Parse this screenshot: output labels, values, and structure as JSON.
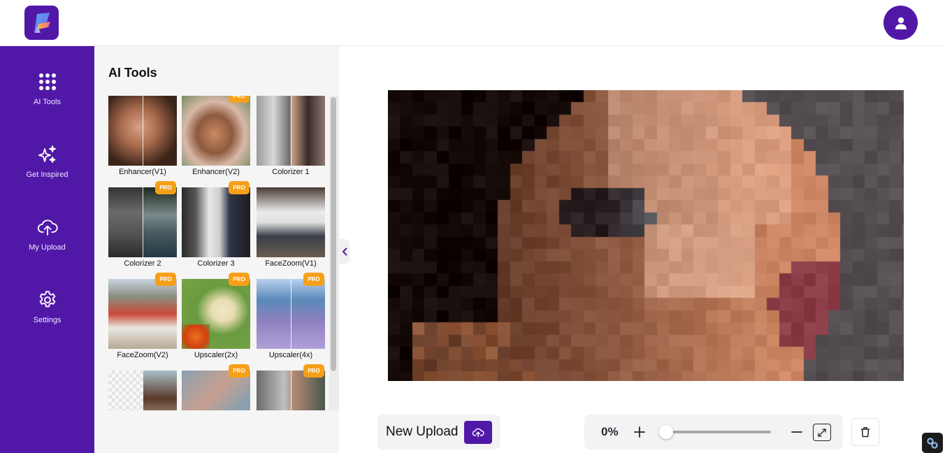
{
  "header": {
    "logo_icon": "app-logo",
    "profile_icon": "user-icon"
  },
  "sidebar": {
    "items": [
      {
        "label": "AI Tools",
        "icon": "grid-dots-icon",
        "active": true
      },
      {
        "label": "Get Inspired",
        "icon": "sparkles-icon"
      },
      {
        "label": "My Upload",
        "icon": "cloud-upload-icon"
      },
      {
        "label": "Settings",
        "icon": "gear-icon"
      }
    ]
  },
  "panel": {
    "title": "AI Tools",
    "pro_label": "PRO",
    "tools": [
      {
        "name": "Enhancer(V1)",
        "pro": false
      },
      {
        "name": "Enhancer(V2)",
        "pro": true
      },
      {
        "name": "Colorizer 1",
        "pro": false
      },
      {
        "name": "Colorizer 2",
        "pro": true
      },
      {
        "name": "Colorizer 3",
        "pro": true
      },
      {
        "name": "FaceZoom(V1)",
        "pro": false
      },
      {
        "name": "FaceZoom(V2)",
        "pro": true
      },
      {
        "name": "Upscaler(2x)",
        "pro": true
      },
      {
        "name": "Upscaler(4x)",
        "pro": true
      },
      {
        "name": "",
        "pro": false
      },
      {
        "name": "",
        "pro": true
      },
      {
        "name": "",
        "pro": true
      }
    ]
  },
  "toolbar": {
    "new_upload_label": "New Upload",
    "zoom_value": "0%",
    "zoom_fraction": 0
  },
  "colors": {
    "brand": "#5118a8",
    "pro_badge": "#f6a01a"
  }
}
